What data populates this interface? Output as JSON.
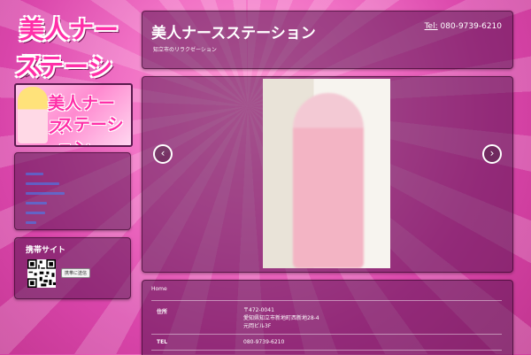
{
  "logo": {
    "line1": "美人ナース",
    "line2": "ステーション"
  },
  "banner": {
    "line1": "美人ナース",
    "line2": "ステーション"
  },
  "header": {
    "title": "美人ナースステーション",
    "subtitle": "知立市のリラクゼーション",
    "tel_label": "Tel:",
    "tel_number": "080-9739-6210"
  },
  "sidebar": {
    "nav_items": [
      "item1",
      "item2",
      "item3",
      "item4",
      "item5",
      "item6"
    ],
    "mobile_title": "携帯サイト",
    "mobile_button": "携帯に送信"
  },
  "slider": {
    "prev_icon": "chevron-left-icon",
    "next_icon": "chevron-right-icon"
  },
  "info": {
    "breadcrumb": "Home",
    "address_label": "住所",
    "address_value": "〒472-0041\n愛知県知立市新地町西新地28-4\n元岡ビル3F",
    "tel_label": "TEL",
    "tel_value": "080-9739-6210"
  },
  "colors": {
    "accent_pink": "#ff2fa8",
    "panel": "#5a1450",
    "link_blue": "#3a86ff"
  }
}
